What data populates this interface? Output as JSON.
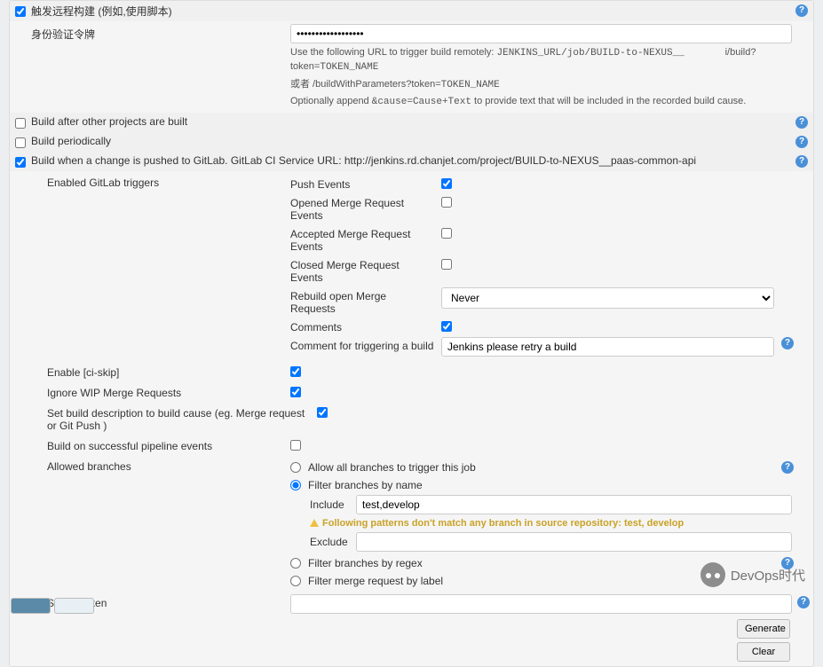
{
  "section": {
    "triggerRemote": {
      "label": "触发远程构建 (例如,使用脚本)",
      "checked": true,
      "token": {
        "label": "身份验证令牌",
        "value": "••••••••••••••••••"
      },
      "hint1_pre": "Use the following URL to trigger build remotely: ",
      "hint1_code": "JENKINS_URL/job/BUILD-to-NEXUS__",
      "hint1_mid": "i/build?token=",
      "hint1_code2": "TOKEN_NAME",
      "hint2_pre": "或者 /buildWithParameters?token=",
      "hint2_code": "TOKEN_NAME",
      "hint3_pre": "Optionally append ",
      "hint3_code": "&cause=Cause+Text",
      "hint3_post": " to provide text that will be included in the recorded build cause."
    },
    "buildAfter": {
      "label": "Build after other projects are built",
      "checked": false
    },
    "buildPeriodically": {
      "label": "Build periodically",
      "checked": false
    },
    "gitlab": {
      "label": "Build when a change is pushed to GitLab. GitLab CI Service URL: http://jenkins.rd.chanjet.com/project/BUILD-to-NEXUS__paas-common-api",
      "checked": true,
      "enabledTriggers": "Enabled GitLab triggers",
      "pushEvents": {
        "label": "Push Events",
        "checked": true
      },
      "openedMR": {
        "label": "Opened Merge Request Events",
        "checked": false
      },
      "acceptedMR": {
        "label": "Accepted Merge Request Events",
        "checked": false
      },
      "closedMR": {
        "label": "Closed Merge Request Events",
        "checked": false
      },
      "rebuildMR": {
        "label": "Rebuild open Merge Requests",
        "value": "Never"
      },
      "comments": {
        "label": "Comments",
        "checked": true
      },
      "commentTrigger": {
        "label": "Comment for triggering a build",
        "value": "Jenkins please retry a build"
      },
      "ciSkip": {
        "label": "Enable [ci-skip]",
        "checked": true
      },
      "ignoreWIP": {
        "label": "Ignore WIP Merge Requests",
        "checked": true
      },
      "setDesc": {
        "label": "Set build description to build cause (eg. Merge request or Git Push )",
        "checked": true
      },
      "buildPipeline": {
        "label": "Build on successful pipeline events",
        "checked": false
      },
      "allowedBranches": {
        "label": "Allowed branches",
        "allowAll": "Allow all branches to trigger this job",
        "filterByName": "Filter branches by name",
        "include": {
          "label": "Include",
          "value": "test,develop"
        },
        "exclude": {
          "label": "Exclude",
          "value": ""
        },
        "warning": "Following patterns don't match any branch in source repository: test, develop",
        "filterRegex": "Filter branches by regex",
        "filterLabel": "Filter merge request by label",
        "selected": "name"
      },
      "secretToken": {
        "label": "Secret token",
        "value": ""
      },
      "generate": "Generate",
      "clear": "Clear"
    }
  },
  "watermark": "DevOps时代"
}
